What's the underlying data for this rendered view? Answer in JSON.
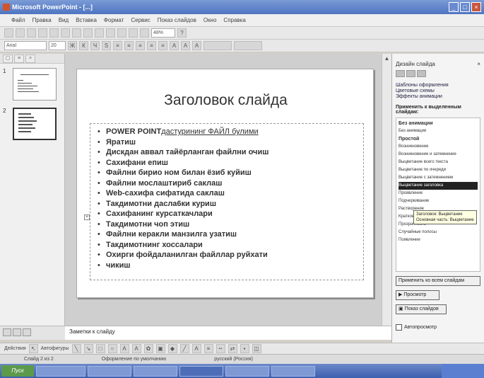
{
  "window": {
    "title": "Microsoft PowerPoint - [...]"
  },
  "menu": [
    "Файл",
    "Правка",
    "Вид",
    "Вставка",
    "Формат",
    "Сервис",
    "Показ слайдов",
    "Окно",
    "Справка"
  ],
  "toolbar": {
    "font": "Arial",
    "size": "20",
    "zoom": "48%"
  },
  "slide_panel": {
    "numbers": [
      "1",
      "2"
    ]
  },
  "slide": {
    "title": "Заголовок слайда",
    "bullets": [
      {
        "bold": "POWER POINT",
        "rest": " дастурининг ФАЙЛ булими"
      },
      {
        "bold": "Яратиш",
        "rest": ""
      },
      {
        "bold": "Дискдан аввал тайёрланган файлни очиш",
        "rest": ""
      },
      {
        "bold": "Сахифани епиш",
        "rest": ""
      },
      {
        "bold": "Файлни бирио ном билан ёзиб куйиш",
        "rest": ""
      },
      {
        "bold": "Файлни мослаштириб саклаш",
        "rest": ""
      },
      {
        "bold": "Web-сахифа сифатида саклаш",
        "rest": ""
      },
      {
        "bold": "Такдимотни дасла6ки куриш",
        "rest": ""
      },
      {
        "bold": "Сахифанинг курсаткачлари",
        "rest": ""
      },
      {
        "bold": "Такдимотни чоп этиш",
        "rest": ""
      },
      {
        "bold": "Файлни керакли манзилга узатиш",
        "rest": ""
      },
      {
        "bold": "Такдимотнинг хоссалари",
        "rest": ""
      },
      {
        "bold": "Охирги фойдаланилган файллар руйхати",
        "rest": ""
      },
      {
        "bold": "чикиш",
        "rest": ""
      }
    ]
  },
  "notes": {
    "placeholder": "Заметки к слайду"
  },
  "task_pane": {
    "title": "Дизайн слайда",
    "links": [
      "Шаблоны оформления",
      "Цветовые схемы",
      "Эффекты анимации"
    ],
    "apply_label": "Применить к выделенным слайдам:",
    "effects": [
      {
        "label": "Без анимации",
        "cat": true
      },
      {
        "label": "Без анимации",
        "cat": false
      },
      {
        "label": "Простой",
        "cat": true
      },
      {
        "label": "Возникновение",
        "cat": false
      },
      {
        "label": "Возникновение и затемнение",
        "cat": false
      },
      {
        "label": "Выцветание всего текста",
        "cat": false
      },
      {
        "label": "Выцветание по очереди",
        "cat": false
      },
      {
        "label": "Выцветание с затемнением",
        "cat": false
      },
      {
        "label": "Выцветание заголовка",
        "cat": false,
        "sel": true
      },
      {
        "label": "Проявление",
        "cat": false
      },
      {
        "label": "Подчеркивание",
        "cat": false
      },
      {
        "label": "Растворение",
        "cat": false
      },
      {
        "label": "Кратковременное расширение",
        "cat": false
      },
      {
        "label": "Прозрачность",
        "cat": false
      },
      {
        "label": "Случайные полосы",
        "cat": false
      },
      {
        "label": "Появление",
        "cat": false
      }
    ],
    "tooltip": [
      "Заголовок: Выцветание",
      "Основная часть: Выцветание"
    ],
    "apply_all": "Применить ко всем слайдам",
    "preview": "Просмотр",
    "slideshow": "Показ слайдов",
    "autopreview": "Автопросмотр"
  },
  "drawbar": {
    "actions": "Действия",
    "autoshapes": "Автофигуры"
  },
  "status": {
    "slide": "Слайд 2 из 2",
    "design": "Оформление по умолчанию",
    "lang": "русский (Россия)"
  },
  "taskbar": {
    "start": "Пуск"
  }
}
